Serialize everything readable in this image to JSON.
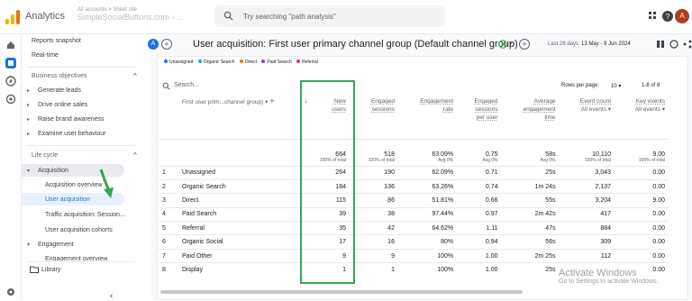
{
  "app": {
    "name": "Analytics",
    "account_line": "All accounts > Sheet site",
    "account_name": "SimpleSocialButtons.com - ...",
    "search_placeholder": "Try searching \"path analysis\"",
    "avatar": "A"
  },
  "colors": {
    "accent": "#1a73e8",
    "highlight_box": "#34a853",
    "arrow": "#34a853"
  },
  "nav": {
    "items": [
      {
        "label": "Reports snapshot"
      },
      {
        "label": "Real-time"
      }
    ],
    "business_objectives": "Business objectives",
    "bo_items": [
      {
        "label": "Generate leads"
      },
      {
        "label": "Drive online sales"
      },
      {
        "label": "Raise brand awareness"
      },
      {
        "label": "Examine user behaviour"
      }
    ],
    "life_cycle": "Life cycle",
    "acquisition": "Acquisition",
    "acq_items": [
      {
        "label": "Acquisition overview"
      },
      {
        "label": "User acquisition"
      },
      {
        "label": "Traffic acquisition: Session..."
      },
      {
        "label": "User acquisition cohorts"
      }
    ],
    "engagement": "Engagement",
    "engagement_overview": "Engagement overview",
    "library": "Library"
  },
  "header": {
    "badge": "A",
    "title": "User acquisition: First user primary channel group (Default channel group)",
    "date_label": "Last 28 days",
    "date_range": "13 May - 9 Jun 2024"
  },
  "legend": [
    {
      "label": "Unassigned",
      "color": "#1a73e8"
    },
    {
      "label": "Organic Search",
      "color": "#12b5cb"
    },
    {
      "label": "Direct",
      "color": "#e37400"
    },
    {
      "label": "Paid Search",
      "color": "#9334e6"
    },
    {
      "label": "Referral",
      "color": "#e52592"
    }
  ],
  "table": {
    "search_placeholder": "Search...",
    "rows_per_page_label": "Rows per page:",
    "rows_per_page": "10",
    "pagination": "1-8 of 8",
    "dim_header": "First user prim...channel group)",
    "headers": [
      {
        "l1": "New",
        "l2": "users",
        "l3": ""
      },
      {
        "l1": "Engaged",
        "l2": "sessions",
        "l3": ""
      },
      {
        "l1": "Engagement",
        "l2": "rate",
        "l3": ""
      },
      {
        "l1": "Engaged",
        "l2": "sessions",
        "l3": "per user"
      },
      {
        "l1": "Average",
        "l2": "engagement",
        "l3": "time"
      },
      {
        "l1": "Event count",
        "l2": "All events",
        "l3": ""
      },
      {
        "l1": "Key events",
        "l2": "All events",
        "l3": ""
      }
    ],
    "totals": [
      {
        "v": "664",
        "s": "100% of total"
      },
      {
        "v": "518",
        "s": "100% of total"
      },
      {
        "v": "63.09%",
        "s": "Avg 0%"
      },
      {
        "v": "0.75",
        "s": "Avg 0%"
      },
      {
        "v": "58s",
        "s": "Avg 0%"
      },
      {
        "v": "10,110",
        "s": "100% of total"
      },
      {
        "v": "9.00",
        "s": "100% of total"
      }
    ],
    "rows": [
      {
        "i": "1",
        "name": "Unassigned",
        "c": [
          "264",
          "190",
          "62.09%",
          "0.71",
          "25s",
          "3,043",
          "0.00"
        ]
      },
      {
        "i": "2",
        "name": "Organic Search",
        "c": [
          "184",
          "136",
          "63.26%",
          "0.74",
          "1m 24s",
          "2,137",
          "0.00"
        ]
      },
      {
        "i": "3",
        "name": "Direct",
        "c": [
          "115",
          "86",
          "51.81%",
          "0.66",
          "55s",
          "3,204",
          "9.00"
        ]
      },
      {
        "i": "4",
        "name": "Paid Search",
        "c": [
          "39",
          "38",
          "97.44%",
          "0.97",
          "2m 42s",
          "417",
          "0.00"
        ]
      },
      {
        "i": "5",
        "name": "Referral",
        "c": [
          "35",
          "42",
          "64.62%",
          "1.11",
          "47s",
          "884",
          "0.00"
        ]
      },
      {
        "i": "6",
        "name": "Organic Social",
        "c": [
          "17",
          "16",
          "80%",
          "0.94",
          "56s",
          "309",
          "0.00"
        ]
      },
      {
        "i": "7",
        "name": "Paid Other",
        "c": [
          "9",
          "9",
          "100%",
          "1.00",
          "2m 25s",
          "112",
          "0.00"
        ]
      },
      {
        "i": "8",
        "name": "Display",
        "c": [
          "1",
          "1",
          "100%",
          "1.00",
          "25s",
          "",
          "0.00"
        ]
      }
    ]
  },
  "watermark": {
    "line1": "Activate Windows",
    "line2": "Go to Settings to activate Windows."
  }
}
